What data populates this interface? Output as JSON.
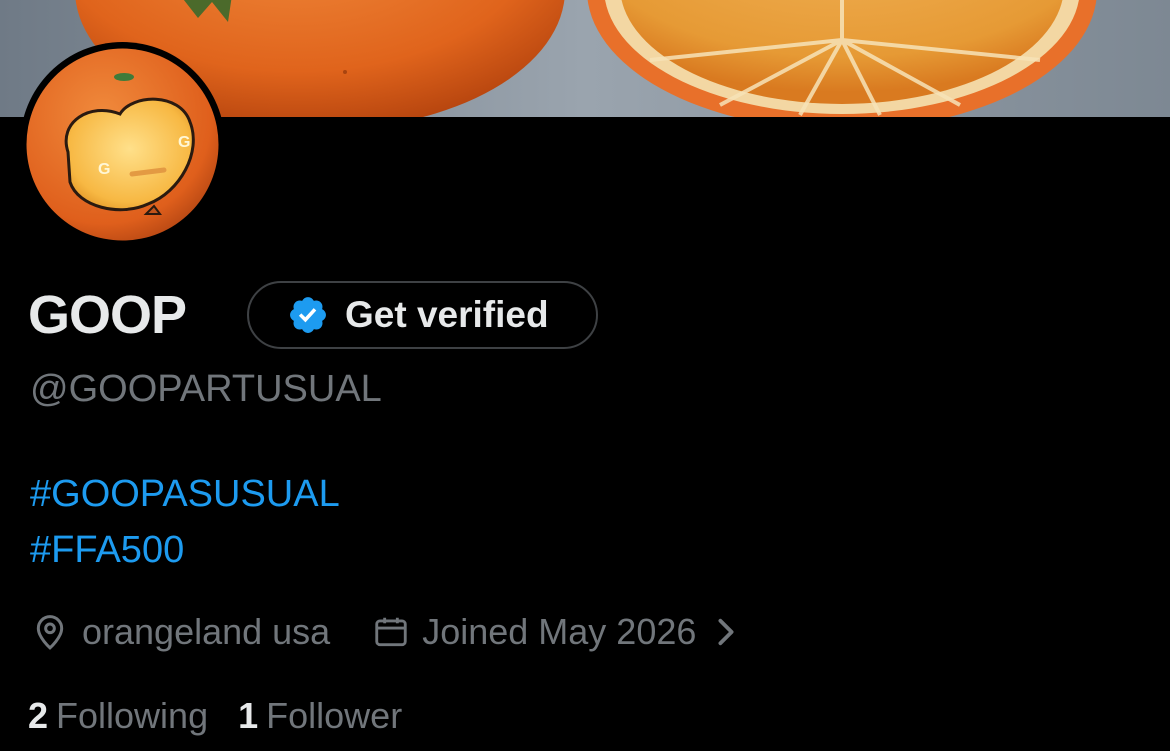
{
  "profile": {
    "display_name": "GOOP",
    "verify_label": "Get verified",
    "handle": "@GOOPARTUSUAL",
    "bio_lines": [
      "#GOOPASUSUAL",
      "#FFA500"
    ],
    "location": "orangeland usa",
    "joined": "Joined May 2026",
    "following_count": "2",
    "following_label": "Following",
    "followers_count": "1",
    "followers_label": "Follower"
  },
  "icons": {
    "verified_badge": "verified-badge-icon",
    "location": "location-pin-icon",
    "joined": "calendar-icon",
    "joined_more": "chevron-right-icon"
  },
  "colors": {
    "background": "#000000",
    "accent_link": "#1d9bf0",
    "muted_text": "#71767b",
    "primary_text": "#e7e9ea",
    "orange": "#FFA500"
  }
}
